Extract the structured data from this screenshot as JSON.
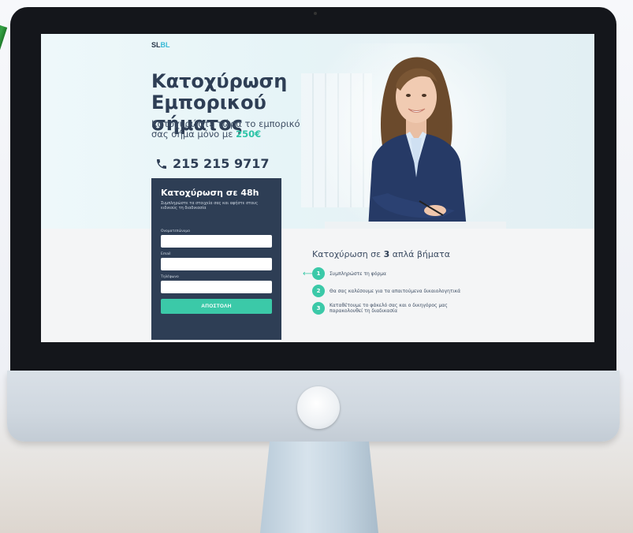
{
  "site": {
    "logo_prefix": "SL",
    "logo_suffix": "BL"
  },
  "hero": {
    "title": "Κατοχύρωση Εμπορικού σήματος",
    "subtitle_text": "Κατοχυρώστε τώρα το εμπορικό σας σήμα μόνο με ",
    "price": "250€",
    "phone": "215 215 9717"
  },
  "form": {
    "title": "Κατοχύρωση σε 48h",
    "description": "Συμπληρώστε τα στοιχεία σας και αφήστε στους ειδικούς τη διαδικασία",
    "fields": [
      {
        "label": "Ονοματεπώνυμο"
      },
      {
        "label": "Email"
      },
      {
        "label": "Τηλέφωνο"
      }
    ],
    "submit_label": "ΑΠΟΣΤΟΛΗ"
  },
  "steps": {
    "title_prefix": "Κατοχύρωση σε ",
    "title_count": "3",
    "title_suffix": " απλά βήματα",
    "items": [
      {
        "num": "1",
        "text": "Συμπληρώστε τη φόρμα"
      },
      {
        "num": "2",
        "text": "Θα σας καλέσουμε για τα απαιτούμενα δικαιολογητικά"
      },
      {
        "num": "3",
        "text": "Καταθέτουμε το φάκελό σας και ο δικηγόρος μας παρακολουθεί τη διαδικασία"
      }
    ]
  },
  "colors": {
    "navy": "#2e3e55",
    "accent_green": "#3bc9a8",
    "hero_bg": "#e6f4f7"
  }
}
